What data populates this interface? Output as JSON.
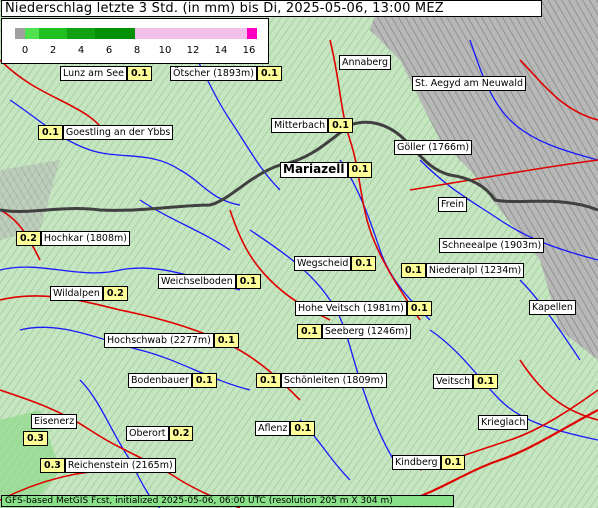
{
  "title": "Niederschlag letzte 3 Std. (in mm) bis Di, 2025-05-06, 13:00 MEZ",
  "legend": {
    "ticks": [
      "0",
      "2",
      "4",
      "6",
      "8",
      "10",
      "12",
      "14",
      "16"
    ],
    "colors": {
      "below_zero": "#a0a0a0",
      "r0_2": "#50e050",
      "r2_4": "#20c020",
      "r4_6": "#10a010",
      "r6_8": "#009000",
      "r8_16": "#f0c0e8",
      "above16": "#ff00c0"
    }
  },
  "stations": [
    {
      "name": "Lunz am See",
      "value": "0.1"
    },
    {
      "name": "Ötscher (1893m)",
      "value": "0.1"
    },
    {
      "name": "Annaberg",
      "value": ""
    },
    {
      "name": "St. Aegyd am Neuwald",
      "value": ""
    },
    {
      "name": "Goestling an der Ybbs",
      "value": "0.1"
    },
    {
      "name": "Mitterbach",
      "value": "0.1"
    },
    {
      "name": "Göller (1766m)",
      "value": ""
    },
    {
      "name": "Mariazell",
      "value": "0.1"
    },
    {
      "name": "Frein",
      "value": ""
    },
    {
      "name": "Hochkar (1808m)",
      "value": "0.2"
    },
    {
      "name": "Schneealpe (1903m)",
      "value": ""
    },
    {
      "name": "Wegscheid",
      "value": "0.1"
    },
    {
      "name": "Niederalpl (1234m)",
      "value": "0.1"
    },
    {
      "name": "Weichselboden",
      "value": "0.1"
    },
    {
      "name": "Wildalpen",
      "value": "0.2"
    },
    {
      "name": "Hohe Veitsch (1981m)",
      "value": "0.1"
    },
    {
      "name": "Kapellen",
      "value": ""
    },
    {
      "name": "Seeberg (1246m)",
      "value": "0.1"
    },
    {
      "name": "Hochschwab (2277m)",
      "value": "0.1"
    },
    {
      "name": "Bodenbauer",
      "value": "0.1"
    },
    {
      "name": "Schönleiten (1809m)",
      "value": "0.1"
    },
    {
      "name": "Veitsch",
      "value": "0.1"
    },
    {
      "name": "Eisenerz",
      "value": "0.3"
    },
    {
      "name": "Oberort",
      "value": "0.2"
    },
    {
      "name": "Aflenz",
      "value": "0.1"
    },
    {
      "name": "Krieglach",
      "value": ""
    },
    {
      "name": "Reichenstein (2165m)",
      "value": "0.3"
    },
    {
      "name": "Kindberg",
      "value": "0.1"
    }
  ],
  "footer": "GFS-based MetGIS Fcst, initialized 2025-05-06, 06:00 UTC  (resolution 205 m X 304 m)"
}
